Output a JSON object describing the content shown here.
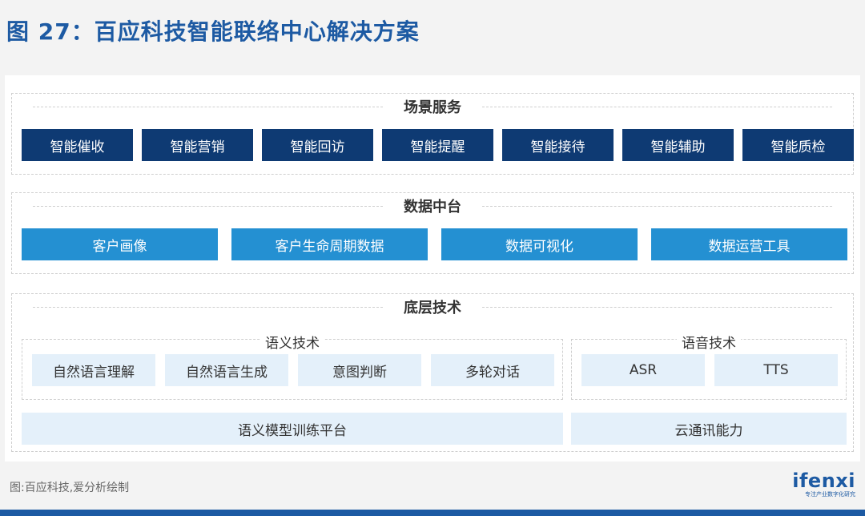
{
  "figure_title": "图 27：百应科技智能联络中心解决方案",
  "scene_layer": {
    "title": "场景服务",
    "items": [
      "智能催收",
      "智能营销",
      "智能回访",
      "智能提醒",
      "智能接待",
      "智能辅助",
      "智能质检"
    ]
  },
  "data_layer": {
    "title": "数据中台",
    "items": [
      "客户画像",
      "客户生命周期数据",
      "数据可视化",
      "数据运营工具"
    ]
  },
  "tech_layer": {
    "title": "底层技术",
    "semantic": {
      "title": "语义技术",
      "items": [
        "自然语言理解",
        "自然语言生成",
        "意图判断",
        "多轮对话"
      ],
      "platform": "语义模型训练平台"
    },
    "voice": {
      "title": "语音技术",
      "items": [
        "ASR",
        "TTS"
      ],
      "platform": "云通讯能力"
    }
  },
  "source": "图:百应科技,爱分析绘制",
  "logo": {
    "word": "ifenxi",
    "tagline": "专注产业数字化研究"
  },
  "colors": {
    "title_blue": "#1d5aa3",
    "dark_box": "#0e3a73",
    "mid_box": "#2490d2",
    "light_box": "#e4f0fa"
  }
}
